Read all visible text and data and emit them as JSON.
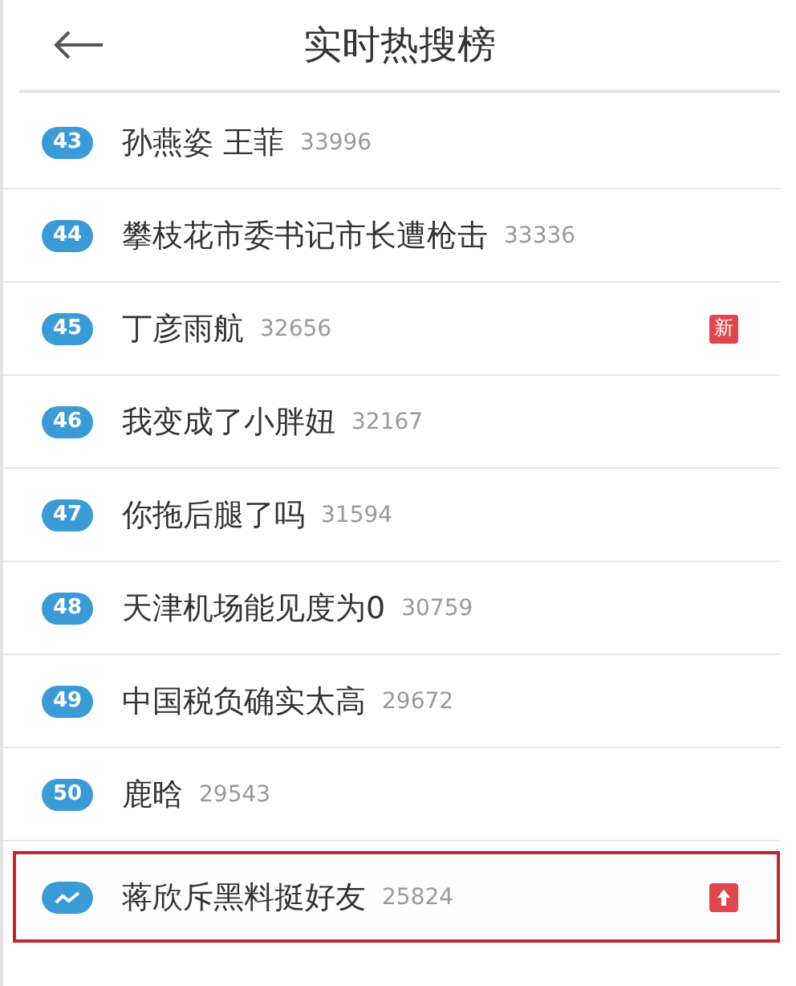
{
  "header": {
    "title": "实时热搜榜"
  },
  "items": [
    {
      "kind": "rank",
      "rank": "43",
      "text": "孙燕姿 王菲",
      "count": "33996",
      "highlighted": false
    },
    {
      "kind": "rank",
      "rank": "44",
      "text": "攀枝花市委书记市长遭枪击",
      "count": "33336",
      "highlighted": false
    },
    {
      "kind": "rank",
      "rank": "45",
      "text": "丁彦雨航",
      "count": "32656",
      "tag": {
        "kind": "new",
        "label": "新"
      },
      "highlighted": false
    },
    {
      "kind": "rank",
      "rank": "46",
      "text": "我变成了小胖妞",
      "count": "32167",
      "highlighted": false
    },
    {
      "kind": "rank",
      "rank": "47",
      "text": "你拖后腿了吗",
      "count": "31594",
      "highlighted": false
    },
    {
      "kind": "rank",
      "rank": "48",
      "text": "天津机场能见度为0",
      "count": "30759",
      "highlighted": false
    },
    {
      "kind": "rank",
      "rank": "49",
      "text": "中国税负确实太高",
      "count": "29672",
      "highlighted": false
    },
    {
      "kind": "rank",
      "rank": "50",
      "text": "鹿晗",
      "count": "29543",
      "highlighted": false
    },
    {
      "kind": "trend",
      "text": "蒋欣斥黑料挺好友",
      "count": "25824",
      "tag": {
        "kind": "rising"
      },
      "highlighted": true
    }
  ]
}
